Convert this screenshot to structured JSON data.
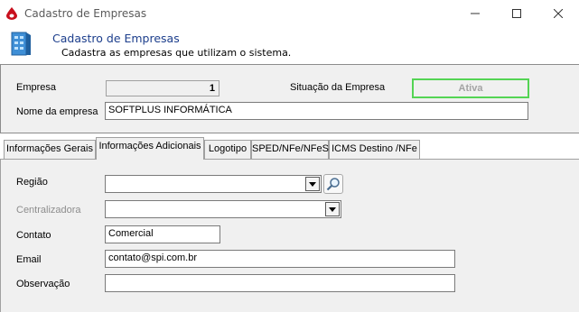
{
  "window": {
    "title": "Cadastro de Empresas"
  },
  "header": {
    "title": "Cadastro de Empresas",
    "subtitle": "Cadastra as empresas que utilizam o sistema."
  },
  "form_top": {
    "empresa_label": "Empresa",
    "empresa_value": "1",
    "situacao_label": "Situação da Empresa",
    "situacao_value": "Ativa",
    "situacao_color": "#54d454",
    "nome_label": "Nome da empresa",
    "nome_value": "SOFTPLUS INFORMÁTICA"
  },
  "tabs": [
    {
      "label": "Informações Gerais"
    },
    {
      "label": "Informações Adicionais"
    },
    {
      "label": "Logotipo"
    },
    {
      "label": "SPED/NFe/NFeS"
    },
    {
      "label": "ICMS Destino /NFe"
    }
  ],
  "active_tab": "Informações Adicionais",
  "adicionais": {
    "regiao_label": "Região",
    "regiao_value": "",
    "centralizadora_label": "Centralizadora",
    "centralizadora_value": "",
    "contato_label": "Contato",
    "contato_value": "Comercial",
    "email_label": "Email",
    "email_value": "contato@spi.com.br",
    "observacao_label": "Observação",
    "observacao_value": ""
  },
  "icons": {
    "app": "droplet-icon",
    "header": "building-icon",
    "lookup": "magnifier-icon",
    "combo": "chevron-down-icon"
  }
}
